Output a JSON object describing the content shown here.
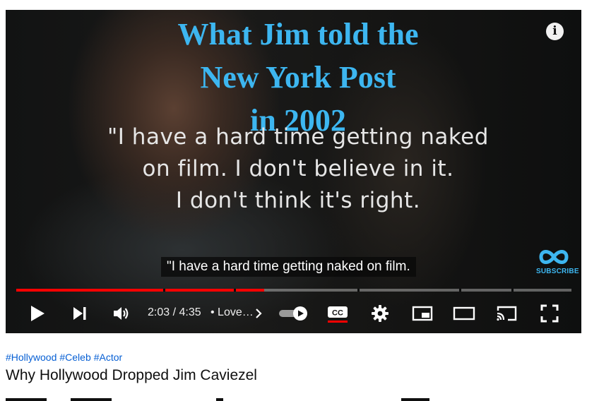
{
  "overlay": {
    "title_lines": [
      "What Jim told the",
      "New York Post",
      "in 2002"
    ],
    "quote_lines": [
      "\"I have a hard time getting naked",
      "on film. I don't believe in it.",
      "I don't think it's right."
    ],
    "caption": "\"I have a hard time getting naked on film.",
    "info_glyph": "i",
    "logo_text": "SUBSCRIBE",
    "accent_color": "#3db6f0"
  },
  "player": {
    "current_time": "2:03",
    "duration": "4:35",
    "time_display": "2:03 / 4:35",
    "chapter_label": "• Love…",
    "progress_fraction": 0.447,
    "progress_color": "#ff0000",
    "autoplay": true,
    "captions_on": true,
    "icons": [
      "play-icon",
      "next-icon",
      "volume-icon",
      "chevron-right-icon",
      "autoplay-toggle",
      "cc-icon",
      "gear-icon",
      "miniplayer-icon",
      "theater-icon",
      "cast-icon",
      "fullscreen-icon"
    ]
  },
  "video": {
    "hashtags": [
      "#Hollywood",
      "#Celeb",
      "#Actor"
    ],
    "title": "Why Hollywood Dropped Jim Caviezel"
  }
}
